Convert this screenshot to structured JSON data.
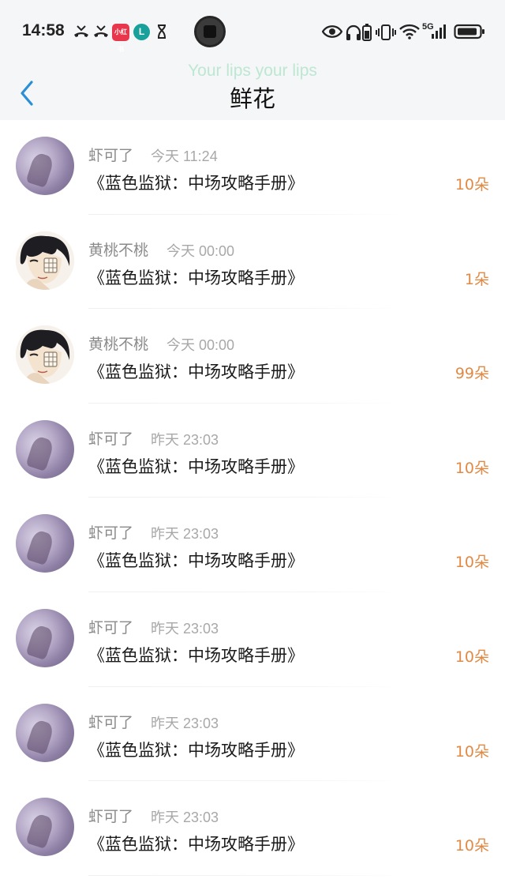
{
  "status_bar": {
    "time": "14:58",
    "app_badge": "小红书",
    "network": "5G",
    "icons": [
      "missed-call-icon",
      "missed-call-icon",
      "app-badge-icon",
      "l-app-icon",
      "hourglass-icon",
      "eye-icon",
      "headphones-icon",
      "battery-small-icon",
      "vibrate-icon",
      "wifi-icon",
      "signal-icon",
      "battery-icon"
    ]
  },
  "header": {
    "lyric": "Your lips  your lips",
    "title": "鲜花",
    "back_icon": "chevron-left-icon",
    "accent_color": "#2b8fd6"
  },
  "items": [
    {
      "name": "虾可了",
      "time": "今天 11:24",
      "book": "《蓝色监狱：中场攻略手册》",
      "count": "10朵",
      "avatar": "purple"
    },
    {
      "name": "黄桃不桃",
      "time": "今天 00:00",
      "book": "《蓝色监狱：中场攻略手册》",
      "count": "1朵",
      "avatar": "anime"
    },
    {
      "name": "黄桃不桃",
      "time": "今天 00:00",
      "book": "《蓝色监狱：中场攻略手册》",
      "count": "99朵",
      "avatar": "anime"
    },
    {
      "name": "虾可了",
      "time": "昨天 23:03",
      "book": "《蓝色监狱：中场攻略手册》",
      "count": "10朵",
      "avatar": "purple"
    },
    {
      "name": "虾可了",
      "time": "昨天 23:03",
      "book": "《蓝色监狱：中场攻略手册》",
      "count": "10朵",
      "avatar": "purple"
    },
    {
      "name": "虾可了",
      "time": "昨天 23:03",
      "book": "《蓝色监狱：中场攻略手册》",
      "count": "10朵",
      "avatar": "purple"
    },
    {
      "name": "虾可了",
      "time": "昨天 23:03",
      "book": "《蓝色监狱：中场攻略手册》",
      "count": "10朵",
      "avatar": "purple"
    },
    {
      "name": "虾可了",
      "time": "昨天 23:03",
      "book": "《蓝色监狱：中场攻略手册》",
      "count": "10朵",
      "avatar": "purple"
    }
  ],
  "colors": {
    "count": "#e08a45",
    "name": "#8a8a8a",
    "timestamp": "#a8a8a8",
    "lyric": "#bde7d3"
  }
}
